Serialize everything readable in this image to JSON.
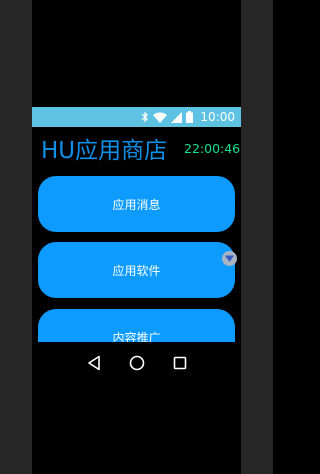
{
  "status_bar": {
    "time": "10:00",
    "color": "#5ec3e3",
    "icons": [
      "bluetooth-icon",
      "wifi-icon",
      "cellular-signal-icon",
      "battery-icon"
    ]
  },
  "header": {
    "title": "HU应用商店",
    "time": "22:00:46",
    "title_color": "#0f8fe8",
    "time_color": "#13e08c"
  },
  "menu": {
    "button_color": "#0d9bff",
    "items": [
      {
        "label": "应用消息"
      },
      {
        "label": "应用软件"
      },
      {
        "label": "内容推广"
      }
    ]
  },
  "nav_bar": {
    "icons": [
      "back-triangle-icon",
      "home-circle-icon",
      "recents-square-icon"
    ]
  },
  "overlay": {
    "icon": "chevron-down-icon"
  }
}
